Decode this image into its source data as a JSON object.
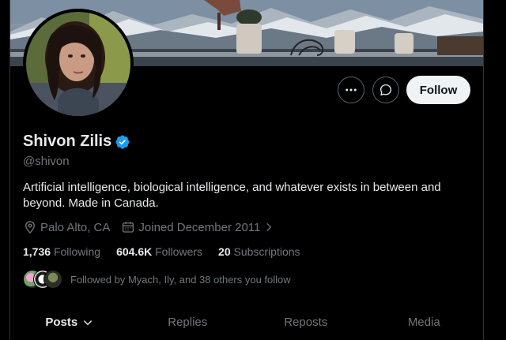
{
  "profile": {
    "name": "Shivon Zilis",
    "handle": "@shivon",
    "bio": "Artificial intelligence, biological intelligence, and whatever exists in between and beyond. Made in Canada.",
    "location": "Palo Alto, CA",
    "joined": "Joined December 2011",
    "verified_icon": "verified-badge-icon"
  },
  "actions": {
    "more_icon": "more-icon",
    "message_icon": "message-icon",
    "follow_label": "Follow"
  },
  "stats": {
    "following_count": "1,736",
    "following_label": "Following",
    "followers_count": "604.6K",
    "followers_label": "Followers",
    "subscriptions_count": "20",
    "subscriptions_label": "Subscriptions"
  },
  "followed_by": {
    "text": "Followed by Myach, Ily, and 38 others you follow"
  },
  "tabs": [
    {
      "label": "Posts",
      "active": true
    },
    {
      "label": "Replies",
      "active": false
    },
    {
      "label": "Reposts",
      "active": false
    },
    {
      "label": "Media",
      "active": false
    }
  ],
  "colors": {
    "background": "#000000",
    "primary_text": "#e7e9ea",
    "secondary_text": "#71767b",
    "verified_blue": "#1d9bf0",
    "follow_bg": "#eff3f4"
  }
}
